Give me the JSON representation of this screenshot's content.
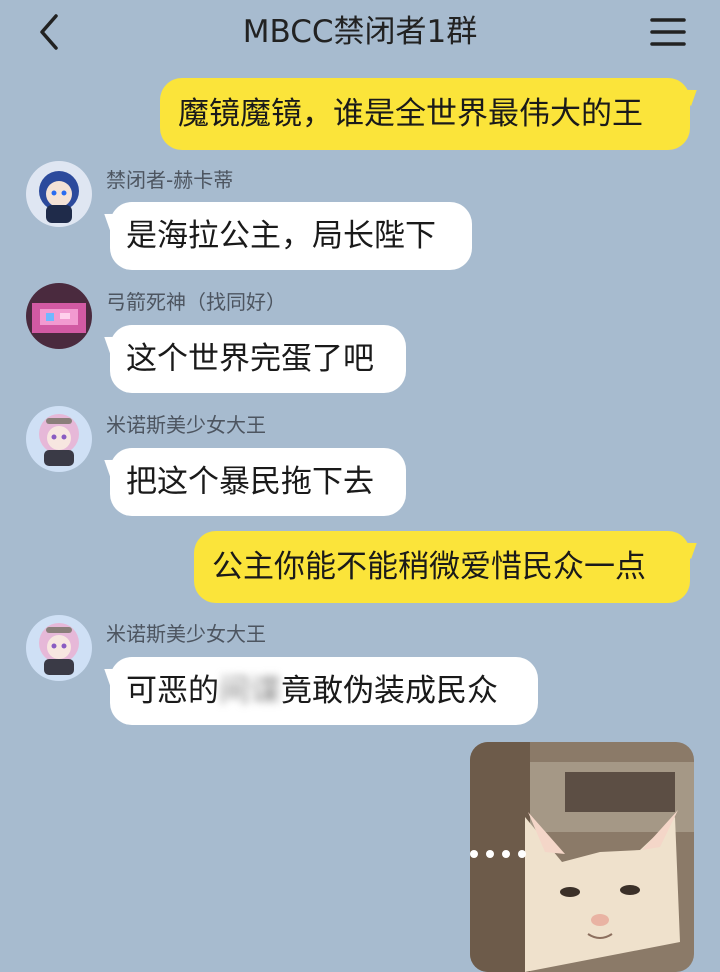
{
  "header": {
    "title": "MBCC禁闭者1群"
  },
  "messages": [
    {
      "side": "me",
      "text": "魔镜魔镜，谁是全世界最伟大的王"
    },
    {
      "side": "other",
      "sender": "禁闭者-赫卡蒂",
      "text": "是海拉公主，局长陛下"
    },
    {
      "side": "other",
      "sender": "弓箭死神（找同好）",
      "text": "这个世界完蛋了吧"
    },
    {
      "side": "other",
      "sender": "米诺斯美少女大王",
      "text": "把这个暴民拖下去"
    },
    {
      "side": "me",
      "text": "公主你能不能稍微爱惜民众一点"
    },
    {
      "side": "other",
      "sender": "米诺斯美少女大王",
      "text_before": "可恶的",
      "text_blur": "间谍",
      "text_after": "竟敢伪装成民众"
    }
  ],
  "colors": {
    "background": "#a7bbcf",
    "my_bubble": "#fbe43a",
    "other_bubble": "#ffffff"
  },
  "icons": {
    "back": "chevron-left-icon",
    "menu": "hamburger-menu-icon"
  },
  "image_message": {
    "subject": "cat-photo"
  }
}
